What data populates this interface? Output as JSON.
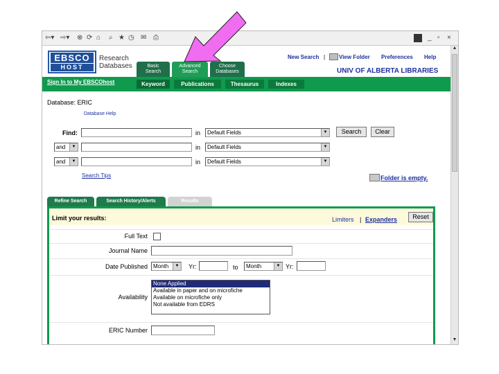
{
  "browser": {
    "toolbar_icons": [
      "back-icon",
      "forward-icon",
      "stop-icon",
      "refresh-icon",
      "home-icon",
      "search-icon",
      "favorites-icon",
      "history-icon",
      "mail-icon",
      "print-icon"
    ]
  },
  "header": {
    "logo_ebsco": "EBSCO",
    "logo_host": "HOST",
    "logo_text_line1": "Research",
    "logo_text_line2": "Databases",
    "tabs": [
      {
        "line1": "Basic",
        "line2": "Search"
      },
      {
        "line1": "Advanced",
        "line2": "Search"
      },
      {
        "line1": "Choose",
        "line2": "Databases"
      }
    ],
    "links": {
      "new_search": "New Search",
      "view_folder": "View Folder",
      "preferences": "Preferences",
      "help": "Help"
    },
    "institution": "UNIV OF ALBERTA LIBRARIES"
  },
  "greenbar": {
    "signin": "Sign In to My EBSCOhost",
    "subtabs": [
      "Keyword",
      "Publications",
      "Thesaurus",
      "Indexes"
    ]
  },
  "search": {
    "database_label": "Database: ERIC",
    "database_help": "Database Help",
    "find_label": "Find:",
    "in_label": "in",
    "field_default": "Default Fields",
    "boolean_default": "and",
    "search_button": "Search",
    "clear_button": "Clear",
    "search_tips": "Search Tips",
    "folder_status": "Folder is empty."
  },
  "lower_tabs": [
    "Refine Search",
    "Search History/Alerts",
    "Results"
  ],
  "refine": {
    "limit_label": "Limit your results:",
    "limiters": "Limiters",
    "separator": "|",
    "expanders": "Expanders",
    "reset_button": "Reset",
    "full_text_label": "Full Text",
    "journal_name_label": "Journal Name",
    "date_published_label": "Date Published",
    "month_default": "Month",
    "yr_label": "Yr:",
    "to_label": "to",
    "availability_label": "Availability",
    "availability_options": [
      "None Applied",
      "Available in paper and on microfiche",
      "Available on microfiche only",
      "Not available from EDRS"
    ],
    "eric_number_label": "ERIC Number"
  },
  "annotation": {
    "arrow_color": "#f06cf0"
  }
}
